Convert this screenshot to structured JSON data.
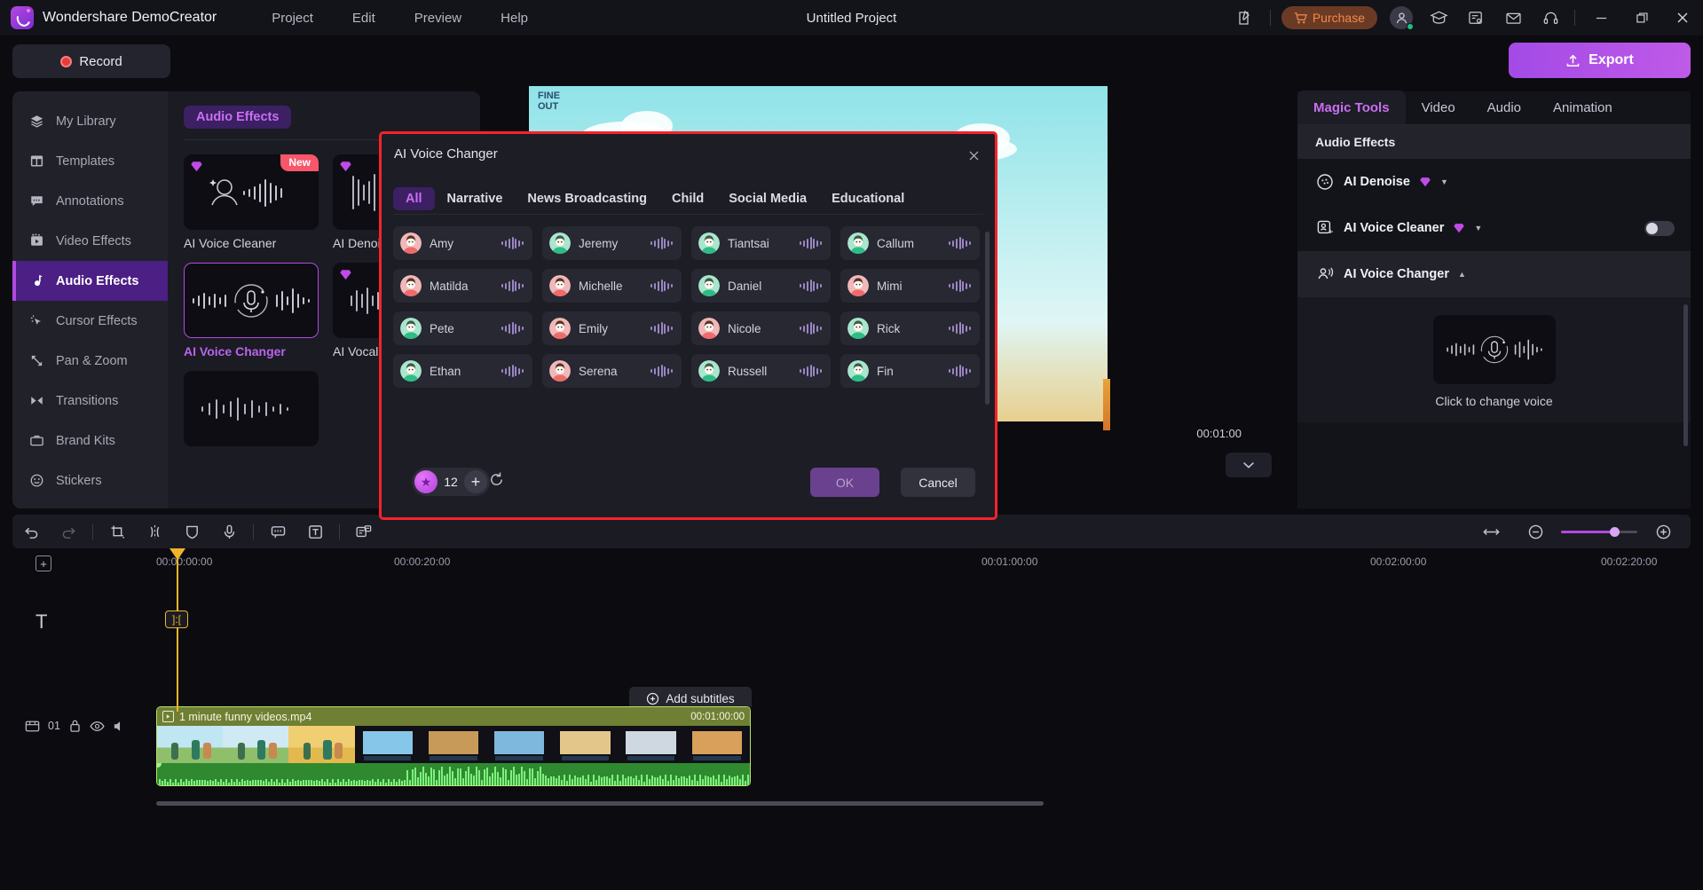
{
  "titlebar": {
    "app_title": "Wondershare DemoCreator",
    "menus": [
      "Project",
      "Edit",
      "Preview",
      "Help"
    ],
    "project_title": "Untitled Project",
    "purchase_label": "Purchase",
    "icons": [
      "feedback-icon",
      "purchase-cart-icon",
      "account-avatar-icon",
      "tutorial-cap-icon",
      "shortcut-icon",
      "mail-icon",
      "headset-icon"
    ],
    "window_controls": [
      "minimize-icon",
      "maximize-icon",
      "close-icon"
    ]
  },
  "toolbar2": {
    "record_label": "Record",
    "export_label": "Export"
  },
  "sidebar": {
    "items": [
      {
        "label": "My Library",
        "icon": "layers-icon"
      },
      {
        "label": "Templates",
        "icon": "template-icon"
      },
      {
        "label": "Annotations",
        "icon": "speech-bubble-icon"
      },
      {
        "label": "Video Effects",
        "icon": "film-effects-icon"
      },
      {
        "label": "Audio Effects",
        "icon": "audio-note-icon"
      },
      {
        "label": "Cursor Effects",
        "icon": "cursor-sparkle-icon"
      },
      {
        "label": "Pan & Zoom",
        "icon": "pan-zoom-icon"
      },
      {
        "label": "Transitions",
        "icon": "transitions-icon"
      },
      {
        "label": "Brand Kits",
        "icon": "brand-kit-icon"
      },
      {
        "label": "Stickers",
        "icon": "sticker-smile-icon"
      }
    ],
    "active_index": 4
  },
  "browser": {
    "chip_label": "Audio Effects",
    "cards": [
      {
        "label": "AI Voice Cleaner",
        "badge": "New",
        "premium": true,
        "selected": false,
        "thumb": "voice-cleaner-thumb"
      },
      {
        "label": "AI Denoise",
        "badge": "",
        "premium": true,
        "selected": false,
        "thumb": "denoise-thumb"
      },
      {
        "label": "AI Voice Changer",
        "badge": "",
        "premium": false,
        "selected": true,
        "thumb": "voice-changer-thumb"
      },
      {
        "label": "AI Vocal Remover",
        "badge": "",
        "premium": true,
        "selected": false,
        "thumb": "vocal-remover-thumb"
      }
    ]
  },
  "preview": {
    "frame_logo_line1": "FINE",
    "frame_logo_line2": "OUT",
    "time_readout": "00:01:00",
    "aspect_label": "chevron-down-icon"
  },
  "dialog": {
    "title": "AI Voice Changer",
    "tabs": [
      "All",
      "Narrative",
      "News Broadcasting",
      "Child",
      "Social Media",
      "Educational"
    ],
    "active_tab": "All",
    "voices": [
      {
        "name": "Amy",
        "avatar": "pink"
      },
      {
        "name": "Jeremy",
        "avatar": "mint"
      },
      {
        "name": "Tiantsai",
        "avatar": "mint"
      },
      {
        "name": "Callum",
        "avatar": "mint"
      },
      {
        "name": "Matilda",
        "avatar": "pink"
      },
      {
        "name": "Michelle",
        "avatar": "pink"
      },
      {
        "name": "Daniel",
        "avatar": "mint"
      },
      {
        "name": "Mimi",
        "avatar": "pink"
      },
      {
        "name": "Pete",
        "avatar": "mint"
      },
      {
        "name": "Emily",
        "avatar": "pink"
      },
      {
        "name": "Nicole",
        "avatar": "pink"
      },
      {
        "name": "Rick",
        "avatar": "mint"
      },
      {
        "name": "Ethan",
        "avatar": "mint"
      },
      {
        "name": "Serena",
        "avatar": "pink"
      },
      {
        "name": "Russell",
        "avatar": "mint"
      },
      {
        "name": "Fin",
        "avatar": "mint"
      }
    ],
    "credits": "12",
    "ok_label": "OK",
    "cancel_label": "Cancel",
    "highlight_color": "#f5232b"
  },
  "right_panel": {
    "tabs": [
      "Magic Tools",
      "Video",
      "Audio",
      "Animation"
    ],
    "active_tab": "Magic Tools",
    "section_title": "Audio Effects",
    "effects": [
      {
        "name": "AI Denoise",
        "premium": true,
        "has_toggle": false,
        "expanded": false,
        "icon": "denoise-icon"
      },
      {
        "name": "AI Voice Cleaner",
        "premium": true,
        "has_toggle": true,
        "expanded": false,
        "icon": "voice-cleaner-icon"
      },
      {
        "name": "AI Voice Changer",
        "premium": false,
        "has_toggle": false,
        "expanded": true,
        "icon": "voice-changer-icon"
      }
    ],
    "voice_changer_caption": "Click to change voice"
  },
  "timeline": {
    "tools": [
      "undo-icon",
      "redo-icon",
      "crop-icon",
      "split-icon",
      "shield-icon",
      "mic-icon",
      "caption-icon",
      "text-icon",
      "sticker-text-icon"
    ],
    "ruler_ticks": [
      "00:00:00:00",
      "00:00:20:00",
      "00:01:00:00",
      "00:02:00:00",
      "00:02:20:00"
    ],
    "playhead_marker": "]:[",
    "add_subtitles_label": "Add subtitles",
    "clip": {
      "name": "1 minute funny videos.mp4",
      "duration": "00:01:00:00"
    },
    "track_number": "01",
    "zoom_controls": [
      "fit-icon",
      "zoom-out-icon",
      "zoom-in-icon"
    ]
  }
}
